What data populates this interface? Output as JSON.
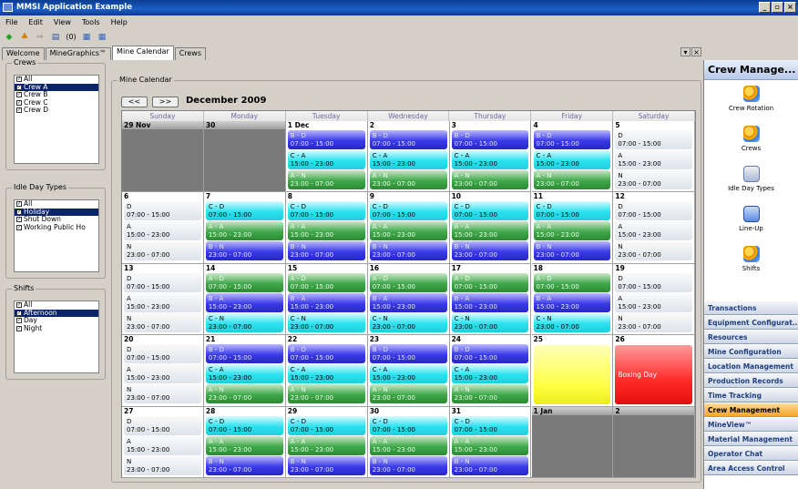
{
  "window": {
    "title": "MMSI Application Example",
    "min": "_",
    "max": "▫",
    "close": "×"
  },
  "menu": [
    "File",
    "Edit",
    "View",
    "Tools",
    "Help"
  ],
  "toolbar": {
    "back": "◆",
    "home": "♣",
    "forward": "⇨",
    "print": "▤",
    "count": "(0)",
    "grid1": "▦",
    "grid2": "▦"
  },
  "tabs": [
    "Welcome",
    "MineGraphics™",
    "Mine Calendar",
    "Crews"
  ],
  "active_tab": 2,
  "left": {
    "crews": {
      "label": "Crews",
      "items": [
        "All",
        "Crew A",
        "Crew B",
        "Crew C",
        "Crew D"
      ],
      "selected": 1
    },
    "idle": {
      "label": "Idle Day Types",
      "items": [
        "All",
        "Holiday",
        "Shut Down",
        "Working Public Ho"
      ],
      "selected": 1
    },
    "shifts": {
      "label": "Shifts",
      "items": [
        "All",
        "Afternoon",
        "Day",
        "Night"
      ],
      "selected": 1
    }
  },
  "calendar": {
    "label": "Mine Calendar",
    "prev": "<<",
    "next": ">>",
    "month": "December 2009",
    "days_of_week": [
      "Sunday",
      "Monday",
      "Tuesday",
      "Wednesday",
      "Thursday",
      "Friday",
      "Saturday"
    ],
    "weeks": [
      [
        {
          "d": "29 Nov",
          "grey": true
        },
        {
          "d": "30",
          "grey": true
        },
        {
          "d": "1 Dec",
          "s": [
            [
              "B - D",
              "07:00 - 15:00",
              "bd"
            ],
            [
              "C - A",
              "15:00 - 23:00",
              "cd"
            ],
            [
              "A - N",
              "23:00 - 07:00",
              "ad"
            ]
          ]
        },
        {
          "d": "2",
          "s": [
            [
              "B - D",
              "07:00 - 15:00",
              "bd"
            ],
            [
              "C - A",
              "15:00 - 23:00",
              "cd"
            ],
            [
              "A - N",
              "23:00 - 07:00",
              "ad"
            ]
          ]
        },
        {
          "d": "3",
          "s": [
            [
              "B - D",
              "07:00 - 15:00",
              "bd"
            ],
            [
              "C - A",
              "15:00 - 23:00",
              "cd"
            ],
            [
              "A - N",
              "23:00 - 07:00",
              "ad"
            ]
          ]
        },
        {
          "d": "4",
          "s": [
            [
              "B - D",
              "07:00 - 15:00",
              "bd"
            ],
            [
              "C - A",
              "15:00 - 23:00",
              "cd"
            ],
            [
              "A - N",
              "23:00 - 07:00",
              "ad"
            ]
          ]
        },
        {
          "d": "5",
          "s": [
            [
              "D",
              "07:00 - 15:00",
              "off"
            ],
            [
              "A",
              "15:00 - 23:00",
              "off"
            ],
            [
              "N",
              "23:00 - 07:00",
              "off"
            ]
          ]
        }
      ],
      [
        {
          "d": "6",
          "s": [
            [
              "D",
              "07:00 - 15:00",
              "off"
            ],
            [
              "A",
              "15:00 - 23:00",
              "off"
            ],
            [
              "N",
              "23:00 - 07:00",
              "off"
            ]
          ]
        },
        {
          "d": "7",
          "s": [
            [
              "C - D",
              "07:00 - 15:00",
              "cd"
            ],
            [
              "A - A",
              "15:00 - 23:00",
              "ad"
            ],
            [
              "B - N",
              "23:00 - 07:00",
              "bd"
            ]
          ]
        },
        {
          "d": "8",
          "s": [
            [
              "C - D",
              "07:00 - 15:00",
              "cd"
            ],
            [
              "A - A",
              "15:00 - 23:00",
              "ad"
            ],
            [
              "B - N",
              "23:00 - 07:00",
              "bd"
            ]
          ]
        },
        {
          "d": "9",
          "s": [
            [
              "C - D",
              "07:00 - 15:00",
              "cd"
            ],
            [
              "A - A",
              "15:00 - 23:00",
              "ad"
            ],
            [
              "B - N",
              "23:00 - 07:00",
              "bd"
            ]
          ]
        },
        {
          "d": "10",
          "s": [
            [
              "C - D",
              "07:00 - 15:00",
              "cd"
            ],
            [
              "A - A",
              "15:00 - 23:00",
              "ad"
            ],
            [
              "B - N",
              "23:00 - 07:00",
              "bd"
            ]
          ]
        },
        {
          "d": "11",
          "s": [
            [
              "C - D",
              "07:00 - 15:00",
              "cd"
            ],
            [
              "A - A",
              "15:00 - 23:00",
              "ad"
            ],
            [
              "B - N",
              "23:00 - 07:00",
              "bd"
            ]
          ]
        },
        {
          "d": "12",
          "s": [
            [
              "D",
              "07:00 - 15:00",
              "off"
            ],
            [
              "A",
              "15:00 - 23:00",
              "off"
            ],
            [
              "N",
              "23:00 - 07:00",
              "off"
            ]
          ]
        }
      ],
      [
        {
          "d": "13",
          "s": [
            [
              "D",
              "07:00 - 15:00",
              "off"
            ],
            [
              "A",
              "15:00 - 23:00",
              "off"
            ],
            [
              "N",
              "23:00 - 07:00",
              "off"
            ]
          ]
        },
        {
          "d": "14",
          "s": [
            [
              "A - D",
              "07:00 - 15:00",
              "ad"
            ],
            [
              "B - A",
              "15:00 - 23:00",
              "bd"
            ],
            [
              "C - N",
              "23:00 - 07:00",
              "cd"
            ]
          ]
        },
        {
          "d": "15",
          "s": [
            [
              "A - D",
              "07:00 - 15:00",
              "ad"
            ],
            [
              "B - A",
              "15:00 - 23:00",
              "bd"
            ],
            [
              "C - N",
              "23:00 - 07:00",
              "cd"
            ]
          ]
        },
        {
          "d": "16",
          "s": [
            [
              "A - D",
              "07:00 - 15:00",
              "ad"
            ],
            [
              "B - A",
              "15:00 - 23:00",
              "bd"
            ],
            [
              "C - N",
              "23:00 - 07:00",
              "cd"
            ]
          ]
        },
        {
          "d": "17",
          "s": [
            [
              "A - D",
              "07:00 - 15:00",
              "ad"
            ],
            [
              "B - A",
              "15:00 - 23:00",
              "bd"
            ],
            [
              "C - N",
              "23:00 - 07:00",
              "cd"
            ]
          ]
        },
        {
          "d": "18",
          "s": [
            [
              "A - D",
              "07:00 - 15:00",
              "ad"
            ],
            [
              "B - A",
              "15:00 - 23:00",
              "bd"
            ],
            [
              "C - N",
              "23:00 - 07:00",
              "cd"
            ]
          ]
        },
        {
          "d": "19",
          "s": [
            [
              "D",
              "07:00 - 15:00",
              "off"
            ],
            [
              "A",
              "15:00 - 23:00",
              "off"
            ],
            [
              "N",
              "23:00 - 07:00",
              "off"
            ]
          ]
        }
      ],
      [
        {
          "d": "20",
          "s": [
            [
              "D",
              "07:00 - 15:00",
              "off"
            ],
            [
              "A",
              "15:00 - 23:00",
              "off"
            ],
            [
              "N",
              "23:00 - 07:00",
              "off"
            ]
          ]
        },
        {
          "d": "21",
          "s": [
            [
              "B - D",
              "07:00 - 15:00",
              "bd"
            ],
            [
              "C - A",
              "15:00 - 23:00",
              "cd"
            ],
            [
              "A - N",
              "23:00 - 07:00",
              "ad"
            ]
          ]
        },
        {
          "d": "22",
          "s": [
            [
              "B - D",
              "07:00 - 15:00",
              "bd"
            ],
            [
              "C - A",
              "15:00 - 23:00",
              "cd"
            ],
            [
              "A - N",
              "23:00 - 07:00",
              "ad"
            ]
          ]
        },
        {
          "d": "23",
          "s": [
            [
              "B - D",
              "07:00 - 15:00",
              "bd"
            ],
            [
              "C - A",
              "15:00 - 23:00",
              "cd"
            ],
            [
              "A - N",
              "23:00 - 07:00",
              "ad"
            ]
          ]
        },
        {
          "d": "24",
          "s": [
            [
              "B - D",
              "07:00 - 15:00",
              "bd"
            ],
            [
              "C - A",
              "15:00 - 23:00",
              "cd"
            ],
            [
              "A - N",
              "23:00 - 07:00",
              "ad"
            ]
          ]
        },
        {
          "d": "25",
          "special": "yellow",
          "text": ""
        },
        {
          "d": "26",
          "special": "red",
          "text": "Boxing Day"
        }
      ],
      [
        {
          "d": "27",
          "s": [
            [
              "D",
              "07:00 - 15:00",
              "off"
            ],
            [
              "A",
              "15:00 - 23:00",
              "off"
            ],
            [
              "N",
              "23:00 - 07:00",
              "off"
            ]
          ]
        },
        {
          "d": "28",
          "s": [
            [
              "C - D",
              "07:00 - 15:00",
              "cd"
            ],
            [
              "A - A",
              "15:00 - 23:00",
              "ad"
            ],
            [
              "B - N",
              "23:00 - 07:00",
              "bd"
            ]
          ]
        },
        {
          "d": "29",
          "s": [
            [
              "C - D",
              "07:00 - 15:00",
              "cd"
            ],
            [
              "A - A",
              "15:00 - 23:00",
              "ad"
            ],
            [
              "B - N",
              "23:00 - 07:00",
              "bd"
            ]
          ]
        },
        {
          "d": "30",
          "s": [
            [
              "C - D",
              "07:00 - 15:00",
              "cd"
            ],
            [
              "A - A",
              "15:00 - 23:00",
              "ad"
            ],
            [
              "B - N",
              "23:00 - 07:00",
              "bd"
            ]
          ]
        },
        {
          "d": "31",
          "s": [
            [
              "C - D",
              "07:00 - 15:00",
              "cd"
            ],
            [
              "A - A",
              "15:00 - 23:00",
              "ad"
            ],
            [
              "B - N",
              "23:00 - 07:00",
              "bd"
            ]
          ]
        },
        {
          "d": "1 Jan",
          "grey": true
        },
        {
          "d": "2",
          "grey": true
        }
      ]
    ]
  },
  "right": {
    "title": "Crew Manage...",
    "icons": [
      {
        "label": "Crew Rotation",
        "icon": "crew-rotation-icon"
      },
      {
        "label": "Crews",
        "icon": "crews-icon"
      },
      {
        "label": "Idle Day Types",
        "icon": "idle-day-types-icon"
      },
      {
        "label": "Line-Up",
        "icon": "line-up-icon"
      },
      {
        "label": "Shifts",
        "icon": "shifts-icon"
      }
    ],
    "nav": [
      "Transactions",
      "Equipment Configurat...",
      "Resources",
      "Mine Configuration",
      "Location Management",
      "Production Records",
      "Time Tracking",
      "Crew Management",
      "MineView™",
      "Material Management",
      "Operator Chat",
      "Area Access Control"
    ],
    "nav_active": 7
  }
}
